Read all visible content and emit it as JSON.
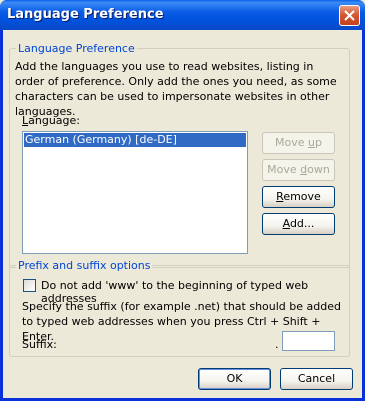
{
  "window": {
    "title": "Language Preference"
  },
  "language_group": {
    "legend": "Language Preference",
    "description": "Add the languages you use to read websites, listing in order of preference. Only add the ones you need, as some characters can be used to impersonate websites in other languages.",
    "list_label": "Language:",
    "languages": [
      "German (Germany) [de-DE]"
    ],
    "buttons": {
      "move_up": "Move up",
      "move_down": "Move down",
      "remove": "Remove",
      "add": "Add..."
    }
  },
  "prefix_group": {
    "legend": "Prefix and suffix options",
    "checkbox_label": "Do not add 'www' to the beginning of typed web addresses",
    "checkbox_checked": false,
    "suffix_description": "Specify the suffix (for example .net) that should be added to typed web addresses when you press Ctrl + Shift + Enter.",
    "suffix_label": "Suffix:",
    "suffix_dot": ".",
    "suffix_value": ""
  },
  "footer": {
    "ok": "OK",
    "cancel": "Cancel"
  }
}
